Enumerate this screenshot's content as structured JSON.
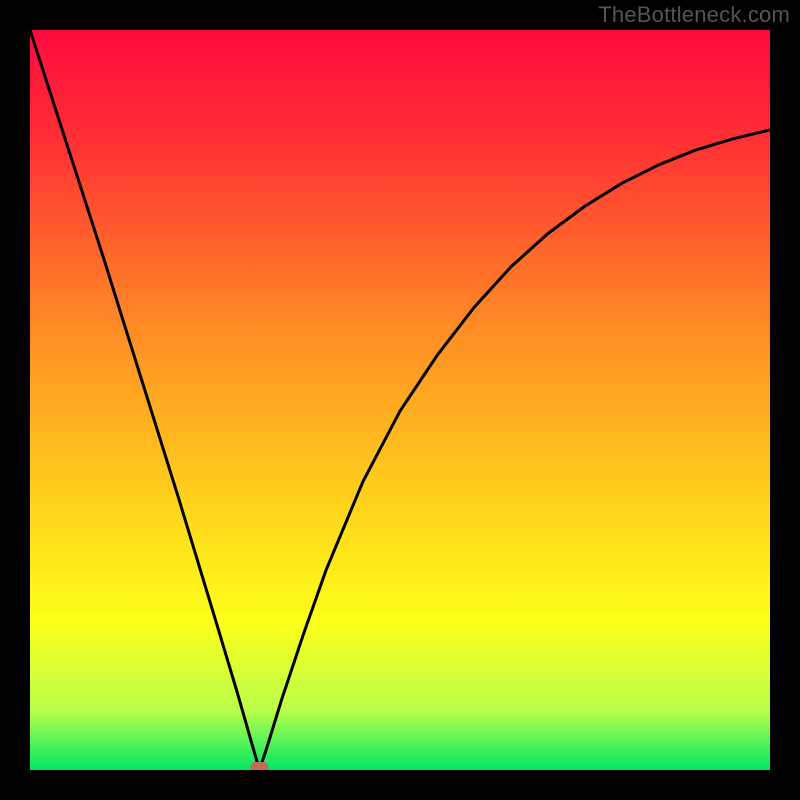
{
  "watermark": "TheBottleneck.com",
  "chart_data": {
    "type": "line",
    "title": "",
    "xlabel": "",
    "ylabel": "",
    "xlim": [
      0,
      1
    ],
    "ylim": [
      0,
      1
    ],
    "legend": false,
    "grid": false,
    "background_gradient": {
      "direction": "vertical",
      "stops": [
        {
          "offset": 0.0,
          "color": "#ff0b3e"
        },
        {
          "offset": 0.15,
          "color": "#ff3034"
        },
        {
          "offset": 0.4,
          "color": "#ff8b25"
        },
        {
          "offset": 0.65,
          "color": "#ffd61b"
        },
        {
          "offset": 0.8,
          "color": "#fdff1a"
        },
        {
          "offset": 0.92,
          "color": "#b8ff4a"
        },
        {
          "offset": 1.0,
          "color": "#00e763"
        }
      ]
    },
    "minimum_marker": {
      "x": 0.31,
      "y": 0.0,
      "color": "#c86a5a"
    },
    "series": [
      {
        "name": "curve",
        "color": "#000000",
        "x": [
          0.0,
          0.05,
          0.1,
          0.15,
          0.2,
          0.25,
          0.28,
          0.3,
          0.31,
          0.32,
          0.34,
          0.37,
          0.4,
          0.45,
          0.5,
          0.55,
          0.6,
          0.65,
          0.7,
          0.75,
          0.8,
          0.85,
          0.9,
          0.95,
          1.0
        ],
        "values": [
          1.0,
          0.845,
          0.69,
          0.53,
          0.37,
          0.205,
          0.105,
          0.035,
          0.0,
          0.03,
          0.095,
          0.185,
          0.27,
          0.39,
          0.485,
          0.56,
          0.625,
          0.68,
          0.725,
          0.762,
          0.793,
          0.818,
          0.838,
          0.853,
          0.865
        ]
      }
    ]
  }
}
